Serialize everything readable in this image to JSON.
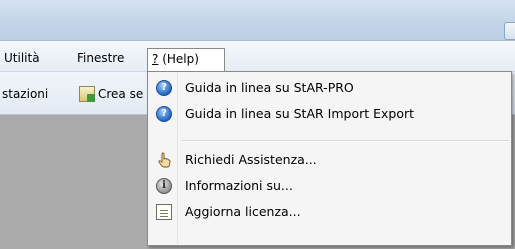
{
  "menubar": {
    "items": [
      "Utilità",
      "Finestre"
    ],
    "help_accel": "?",
    "help_rest": " (Help)"
  },
  "toolbar": {
    "left_label": "stazioni",
    "create_label": "Crea se"
  },
  "help_menu": {
    "items": [
      {
        "label": "Guida in linea su StAR-PRO",
        "icon": "help-icon"
      },
      {
        "label": "Guida in linea su StAR Import Export",
        "icon": "help-icon"
      },
      {
        "label": "Richiedi Assistenza...",
        "icon": "hand-pointer-icon"
      },
      {
        "label": "Informazioni su...",
        "icon": "info-icon"
      },
      {
        "label": "Aggiorna licenza...",
        "icon": "document-icon"
      }
    ]
  },
  "colors": {
    "menu_background": "#f5f5f5",
    "help_icon_blue": "#2266c4",
    "workspace_gray": "#aaaaaa"
  }
}
